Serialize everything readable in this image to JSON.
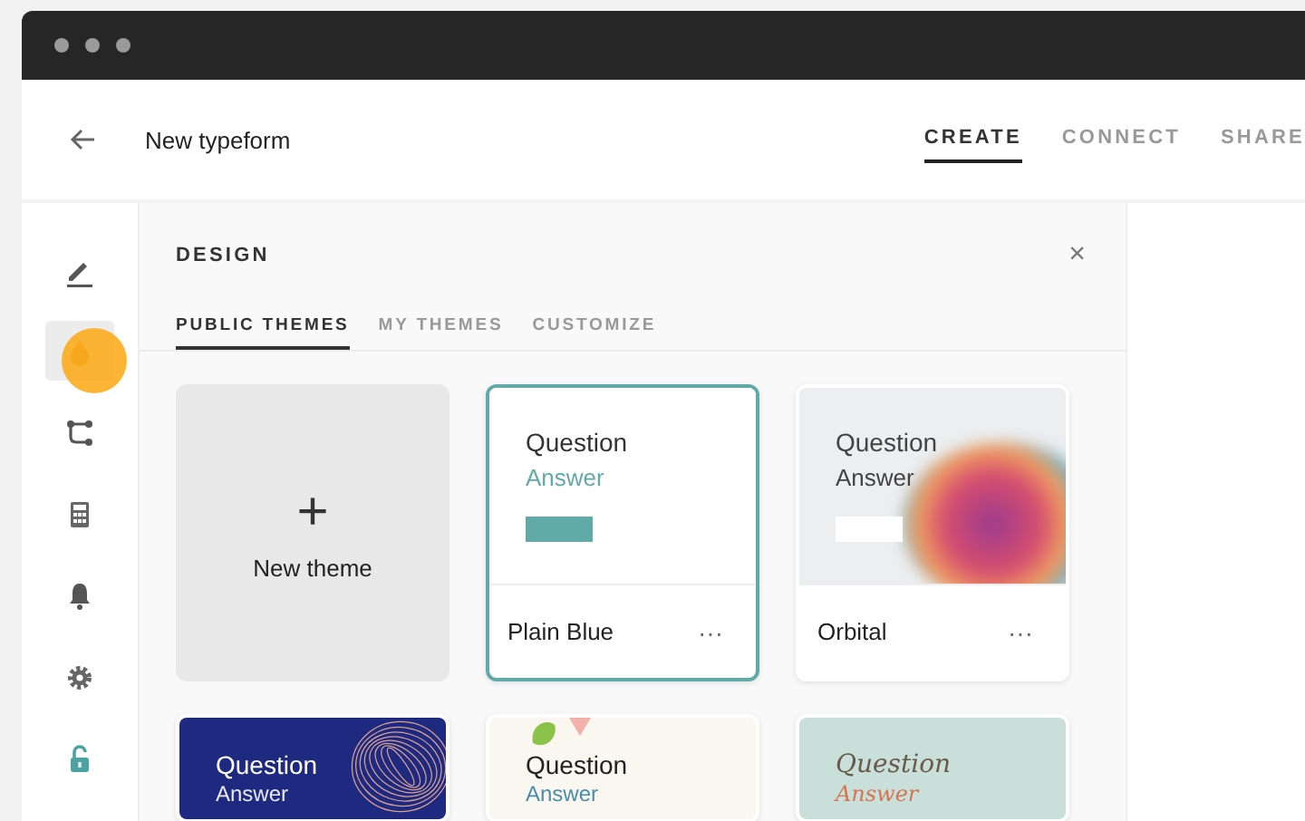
{
  "header": {
    "title": "New typeform",
    "nav": [
      {
        "label": "CREATE",
        "selected": true
      },
      {
        "label": "CONNECT",
        "selected": false
      },
      {
        "label": "SHARE",
        "selected": false
      }
    ]
  },
  "sidebar": {
    "items": [
      {
        "kind": "pencil",
        "selected": false
      },
      {
        "kind": "drop",
        "selected": true
      },
      {
        "kind": "branch",
        "selected": false
      },
      {
        "kind": "calculator",
        "selected": false
      },
      {
        "kind": "bell",
        "selected": false
      },
      {
        "kind": "gear",
        "selected": false
      },
      {
        "kind": "lock",
        "selected": false
      }
    ]
  },
  "panel": {
    "title": "DESIGN",
    "close": "×",
    "tabs": [
      {
        "label": "PUBLIC THEMES",
        "selected": true
      },
      {
        "label": "MY THEMES",
        "selected": false
      },
      {
        "label": "CUSTOMIZE",
        "selected": false
      }
    ],
    "new_theme": {
      "icon": "+",
      "label": "New theme"
    },
    "themes": [
      {
        "kind": "plain",
        "question": "Question",
        "answer": "Answer",
        "name": "Plain Blue",
        "menu": "···",
        "selected": true
      },
      {
        "kind": "orbital",
        "question": "Question",
        "answer": "Answer",
        "name": "Orbital",
        "menu": "···",
        "selected": false
      },
      {
        "kind": "wave",
        "question": "Question",
        "answer": "Answer",
        "selected": false
      },
      {
        "kind": "blobs",
        "question": "Question",
        "answer": "Answer",
        "selected": false
      },
      {
        "kind": "script",
        "question": "Question",
        "answer": "Answer",
        "selected": false
      }
    ]
  }
}
